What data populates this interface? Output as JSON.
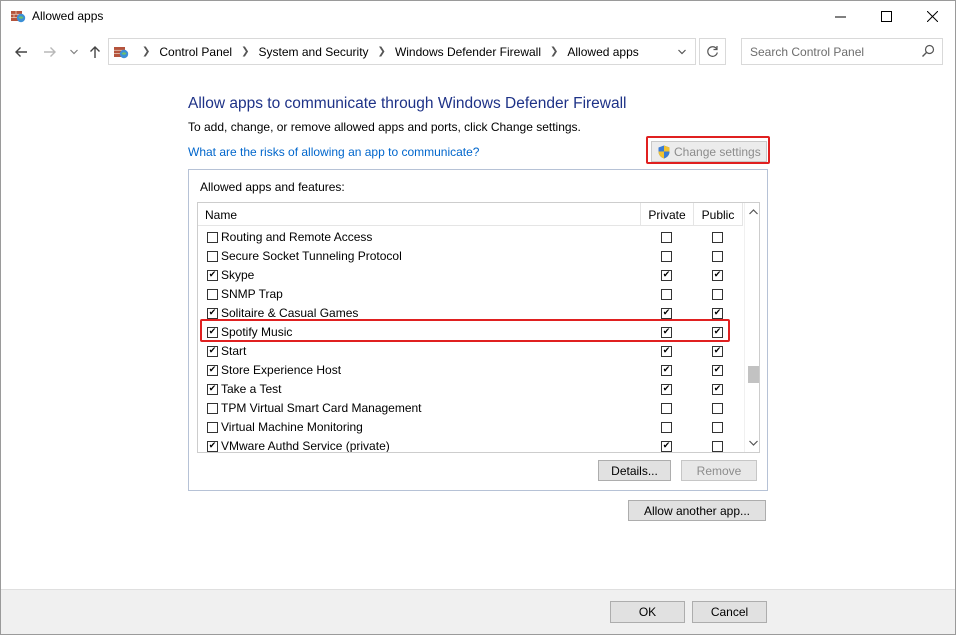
{
  "window": {
    "title": "Allowed apps",
    "minimize_glyph": "—",
    "maximize_glyph": "☐",
    "close_glyph": "✕"
  },
  "nav": {
    "back_icon": "arrow-left-icon",
    "forward_icon": "arrow-right-icon",
    "recent_icon": "chevron-down-icon",
    "up_icon": "arrow-up-icon",
    "breadcrumbs": [
      "Control Panel",
      "System and Security",
      "Windows Defender Firewall",
      "Allowed apps"
    ],
    "refresh_icon": "refresh-icon",
    "search_placeholder": "Search Control Panel"
  },
  "content": {
    "heading": "Allow apps to communicate through Windows Defender Firewall",
    "subtext": "To add, change, or remove allowed apps and ports, click Change settings.",
    "risk_link": "What are the risks of allowing an app to communicate?",
    "change_settings_label": "Change settings",
    "group_label": "Allowed apps and features:",
    "columns": {
      "name": "Name",
      "private": "Private",
      "public": "Public"
    },
    "apps": [
      {
        "name": "Routing and Remote Access",
        "enabled": false,
        "private": false,
        "public": false
      },
      {
        "name": "Secure Socket Tunneling Protocol",
        "enabled": false,
        "private": false,
        "public": false
      },
      {
        "name": "Skype",
        "enabled": true,
        "private": true,
        "public": true
      },
      {
        "name": "SNMP Trap",
        "enabled": false,
        "private": false,
        "public": false
      },
      {
        "name": "Solitaire & Casual Games",
        "enabled": true,
        "private": true,
        "public": true
      },
      {
        "name": "Spotify Music",
        "enabled": true,
        "private": true,
        "public": true
      },
      {
        "name": "Start",
        "enabled": true,
        "private": true,
        "public": true
      },
      {
        "name": "Store Experience Host",
        "enabled": true,
        "private": true,
        "public": true
      },
      {
        "name": "Take a Test",
        "enabled": true,
        "private": true,
        "public": true
      },
      {
        "name": "TPM Virtual Smart Card Management",
        "enabled": false,
        "private": false,
        "public": false
      },
      {
        "name": "Virtual Machine Monitoring",
        "enabled": false,
        "private": false,
        "public": false
      },
      {
        "name": "VMware Authd Service (private)",
        "enabled": true,
        "private": true,
        "public": false
      }
    ],
    "highlighted_app": "Spotify Music",
    "details_label": "Details...",
    "remove_label": "Remove",
    "allow_another_label": "Allow another app..."
  },
  "footer": {
    "ok_label": "OK",
    "cancel_label": "Cancel"
  },
  "colors": {
    "heading": "#1e3287",
    "link": "#0066cc",
    "highlight": "#e02020",
    "disabled_text": "#8c8c8c"
  }
}
